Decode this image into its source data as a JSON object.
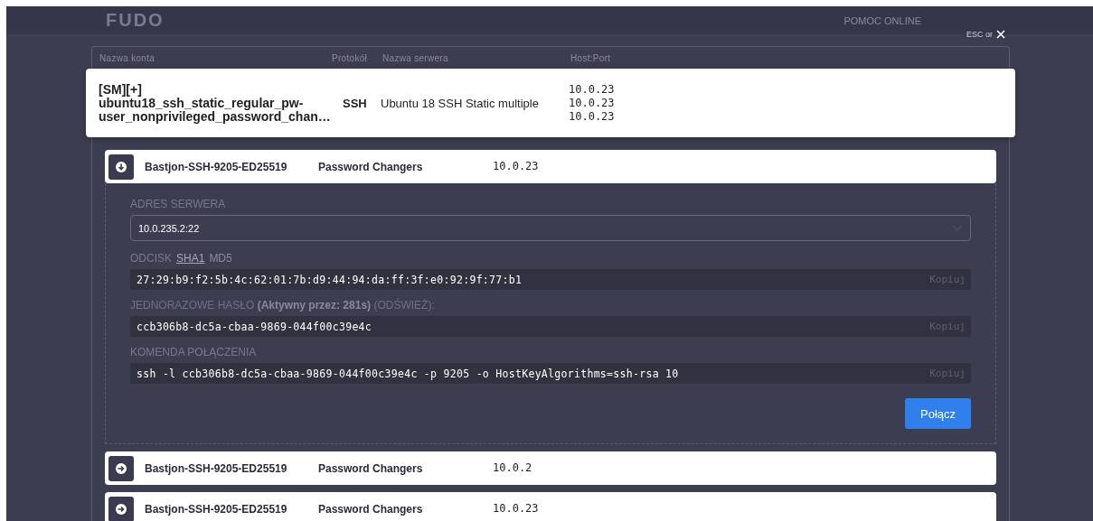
{
  "header": {
    "logo": "FUDO",
    "help": "POMOC ONLINE"
  },
  "close": {
    "hint": "ESC or"
  },
  "table": {
    "columns": [
      "Nazwa konta",
      "Protokół",
      "Nazwa serwera",
      "Host:Port"
    ]
  },
  "account": {
    "name": "[SM][+] ubuntu18_ssh_static_regular_pw-user_nonprivileged_password_chan…",
    "protocol": "SSH",
    "server": "Ubuntu 18 SSH Static multiple",
    "hosts": [
      "10.0.23",
      "10.0.23",
      "10.0.23"
    ]
  },
  "bastions": [
    {
      "name": "Bastjon-SSH-9205-ED25519",
      "group": "Password Changers",
      "host": "10.0.23",
      "expanded": true
    },
    {
      "name": "Bastjon-SSH-9205-ED25519",
      "group": "Password Changers",
      "host": "10.0.2",
      "expanded": false
    },
    {
      "name": "Bastjon-SSH-9205-ED25519",
      "group": "Password Changers",
      "host": "10.0.23",
      "expanded": false
    }
  ],
  "details": {
    "server_label": "ADRES SERWERA",
    "server_value": "10.0.235.2:22",
    "fingerprint_label": "ODCISK",
    "fingerprint_tabs": [
      {
        "label": "SHA1",
        "selected": true
      },
      {
        "label": "MD5",
        "selected": false
      }
    ],
    "fingerprint": "27:29:b9:f2:5b:4c:62:01:7b:d9:44:94:da:ff:3f:e0:92:9f:77:b1",
    "fingerprint_copy": "Kopiuj",
    "otp_label": "JEDNORAZOWE HASŁO **(Aktywny przez: 281s)** (ODŚWIEŻ):",
    "otp": "ccb306b8-dc5a-cbaa-9869-044f00c39e4c",
    "otp_copy": "Kopiuj",
    "command_label": "KOMENDA POŁĄCZENIA",
    "command": "ssh -l ccb306b8-dc5a-cbaa-9869-044f00c39e4c -p 9205 -o HostKeyAlgorithms=ssh-rsa 10",
    "command_copy": "Kopiuj",
    "connect": "Połącz"
  }
}
